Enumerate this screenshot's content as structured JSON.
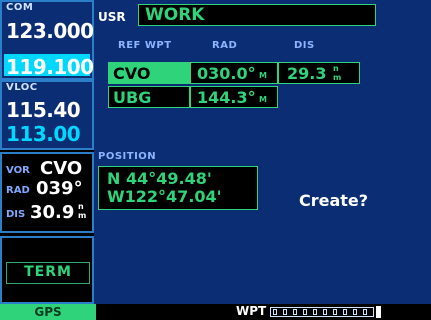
{
  "com": {
    "label": "COM",
    "active": "123.000",
    "standby": "119.100"
  },
  "vloc": {
    "label": "VLOC",
    "active": "115.40",
    "standby": "113.00"
  },
  "vor": {
    "label": "VOR",
    "ident": "CVO",
    "rad_label": "RAD",
    "rad_value": "039°",
    "dis_label": "DIS",
    "dis_value": "30.9",
    "dis_unit_top": "n",
    "dis_unit_bottom": "m"
  },
  "term": {
    "label": "TERM"
  },
  "usr": {
    "label": "USR",
    "name": "WORK"
  },
  "table": {
    "headers": {
      "ref_wpt": "REF WPT",
      "rad": "RAD",
      "dis": "DIS"
    },
    "rows": [
      {
        "ref": "CVO",
        "rad": "030.0°",
        "rad_unit": "M",
        "dis": "29.3",
        "dis_unit_top": "n",
        "dis_unit_bottom": "m"
      },
      {
        "ref": "UBG",
        "rad": "144.3°",
        "rad_unit": "M"
      }
    ]
  },
  "position": {
    "label": "POSITION",
    "lat": "N 44°49.48'",
    "lon": "W122°47.04'"
  },
  "prompt": {
    "create": "Create?"
  },
  "bottom": {
    "gps": "GPS",
    "wpt": "WPT"
  },
  "colors": {
    "panel_blue": "#0a2d73",
    "border_blue": "#2b7fc9",
    "green": "#2fd37a",
    "cyan": "#00d8ff",
    "white": "#ffffff"
  }
}
